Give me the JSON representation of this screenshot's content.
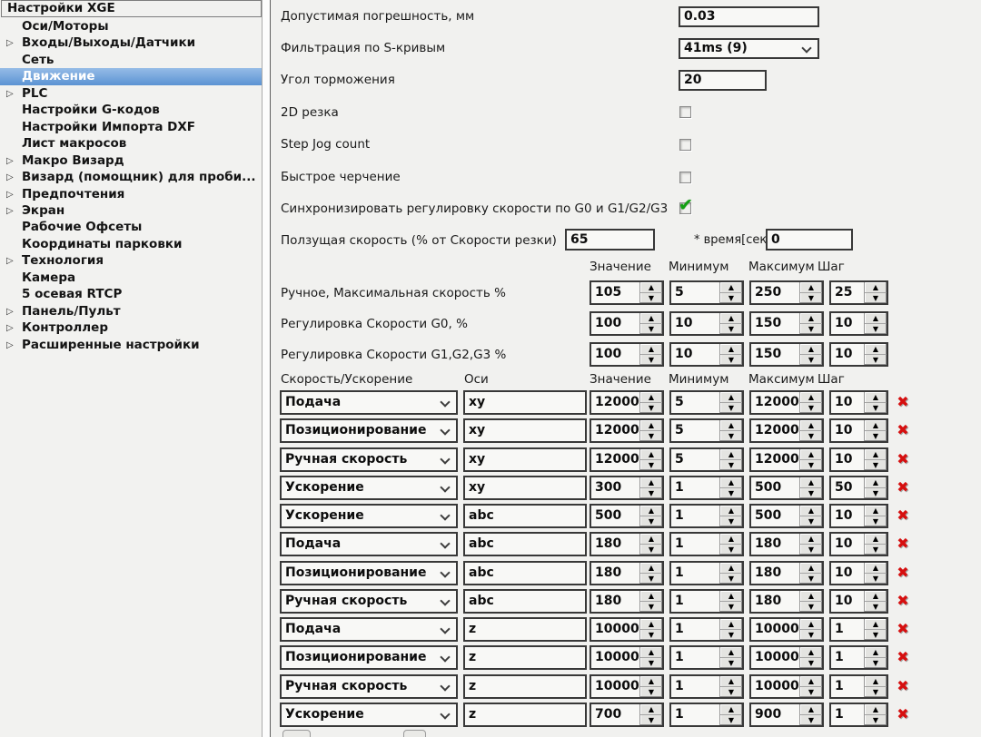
{
  "sidebar": {
    "header": "Настройки XGE",
    "items": [
      {
        "label": "Оси/Моторы",
        "expandable": false,
        "selected": false
      },
      {
        "label": "Входы/Выходы/Датчики",
        "expandable": true,
        "selected": false
      },
      {
        "label": "Сеть",
        "expandable": false,
        "selected": false
      },
      {
        "label": "Движение",
        "expandable": false,
        "selected": true
      },
      {
        "label": "PLC",
        "expandable": true,
        "selected": false
      },
      {
        "label": "Настройки G-кодов",
        "expandable": false,
        "selected": false
      },
      {
        "label": "Настройки Импорта DXF",
        "expandable": false,
        "selected": false
      },
      {
        "label": "Лист макросов",
        "expandable": false,
        "selected": false
      },
      {
        "label": "Макро Визард",
        "expandable": true,
        "selected": false
      },
      {
        "label": "Визард (помощник) для проби...",
        "expandable": true,
        "selected": false
      },
      {
        "label": "Предпочтения",
        "expandable": true,
        "selected": false
      },
      {
        "label": "Экран",
        "expandable": true,
        "selected": false
      },
      {
        "label": "Рабочие Офсеты",
        "expandable": false,
        "selected": false
      },
      {
        "label": "Координаты парковки",
        "expandable": false,
        "selected": false
      },
      {
        "label": "Технология",
        "expandable": true,
        "selected": false
      },
      {
        "label": "Камера",
        "expandable": false,
        "selected": false
      },
      {
        "label": "5 осевая RTCP",
        "expandable": false,
        "selected": false
      },
      {
        "label": "Панель/Пульт",
        "expandable": true,
        "selected": false
      },
      {
        "label": "Контроллер",
        "expandable": true,
        "selected": false
      },
      {
        "label": "Расширенные настройки",
        "expandable": true,
        "selected": false
      }
    ]
  },
  "form": {
    "tolerance_label": "Допустимая погрешность, мм",
    "tolerance_value": "0.03",
    "scurve_label": "Фильтрация по S-кривым",
    "scurve_value": "41ms (9)",
    "brake_label": "Угол торможения",
    "brake_value": "20",
    "cb_2d_label": "2D резка",
    "cb_stepjog_label": "Step Jog count",
    "cb_fastdraw_label": "Быстрое черчение",
    "cb_sync_label": "Синхронизировать регулировку скорости по G0 и G1/G2/G3",
    "creep_label": "Ползущая скорость (% от Скорости резки)",
    "creep_value": "65",
    "time_label": "* время[сек]",
    "time_value": "0"
  },
  "spin_headers": {
    "value": "Значение",
    "min": "Минимум",
    "max": "Максимум",
    "step": "Шаг"
  },
  "spin_rows": [
    {
      "label": "Ручное, Максимальная скорость %",
      "values": [
        "105",
        "5",
        "250",
        "25"
      ]
    },
    {
      "label": "Регулировка Скорости G0, %",
      "values": [
        "100",
        "10",
        "150",
        "10"
      ]
    },
    {
      "label": "Регулировка Скорости G1,G2,G3 %",
      "values": [
        "100",
        "10",
        "150",
        "10"
      ]
    }
  ],
  "table": {
    "headers": {
      "type": "Скорость/Ускорение",
      "axes": "Оси",
      "value": "Значение",
      "min": "Минимум",
      "max": "Максимум",
      "step": "Шаг"
    },
    "rows": [
      {
        "type": "Подача",
        "axes": "xy",
        "values": [
          "12000",
          "5",
          "12000",
          "10"
        ]
      },
      {
        "type": "Позиционирование",
        "axes": "xy",
        "values": [
          "12000",
          "5",
          "12000",
          "10"
        ]
      },
      {
        "type": "Ручная скорость",
        "axes": "xy",
        "values": [
          "12000",
          "5",
          "12000",
          "10"
        ]
      },
      {
        "type": "Ускорение",
        "axes": "xy",
        "values": [
          "300",
          "1",
          "500",
          "50"
        ]
      },
      {
        "type": "Ускорение",
        "axes": "abc",
        "values": [
          "500",
          "1",
          "500",
          "10"
        ]
      },
      {
        "type": "Подача",
        "axes": "abc",
        "values": [
          "180",
          "1",
          "180",
          "10"
        ]
      },
      {
        "type": "Позиционирование",
        "axes": "abc",
        "values": [
          "180",
          "1",
          "180",
          "10"
        ]
      },
      {
        "type": "Ручная скорость",
        "axes": "abc",
        "values": [
          "180",
          "1",
          "180",
          "10"
        ]
      },
      {
        "type": "Подача",
        "axes": "z",
        "values": [
          "10000",
          "1",
          "10000",
          "1"
        ]
      },
      {
        "type": "Позиционирование",
        "axes": "z",
        "values": [
          "10000",
          "1",
          "10000",
          "1"
        ]
      },
      {
        "type": "Ручная скорость",
        "axes": "z",
        "values": [
          "10000",
          "1",
          "10000",
          "1"
        ]
      },
      {
        "type": "Ускорение",
        "axes": "z",
        "values": [
          "700",
          "1",
          "900",
          "1"
        ]
      }
    ]
  },
  "icons": {
    "expander": "triangle-right",
    "checkmark": "green-check",
    "delete": "red-x",
    "spin_up": "triangle-up",
    "spin_down": "triangle-down"
  },
  "colors": {
    "selection_top": "#96bce7",
    "selection_bottom": "#5b93d3",
    "check_green": "#12a012",
    "delete_red": "#d60f0f",
    "background": "#f1f1ef",
    "field_border": "#383838"
  }
}
